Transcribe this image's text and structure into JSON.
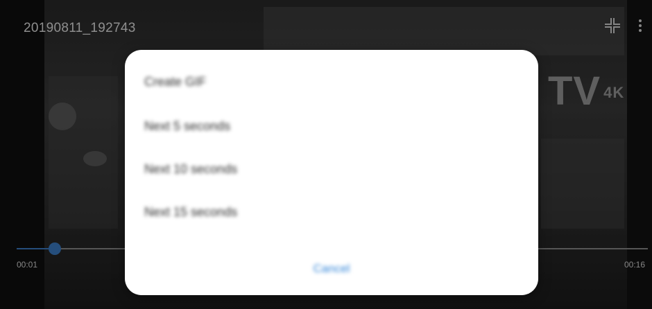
{
  "video": {
    "file_name": "20190811_192743",
    "current_time": "00:01",
    "duration": "00:16",
    "progress_fraction": 0.06,
    "background_logo_text": "TV",
    "background_logo_sub": "4K"
  },
  "icons": {
    "exit_fullscreen": "exit-fullscreen-icon",
    "more": "more-options-icon"
  },
  "dialog": {
    "title": "Create GIF",
    "options": [
      {
        "label": "Next 5 seconds"
      },
      {
        "label": "Next 10 seconds"
      },
      {
        "label": "Next 15 seconds"
      }
    ],
    "cancel_label": "Cancel"
  },
  "colors": {
    "accent": "#3d7fc9",
    "cancel_text": "#2f83d7",
    "dialog_bg": "#ffffff"
  }
}
